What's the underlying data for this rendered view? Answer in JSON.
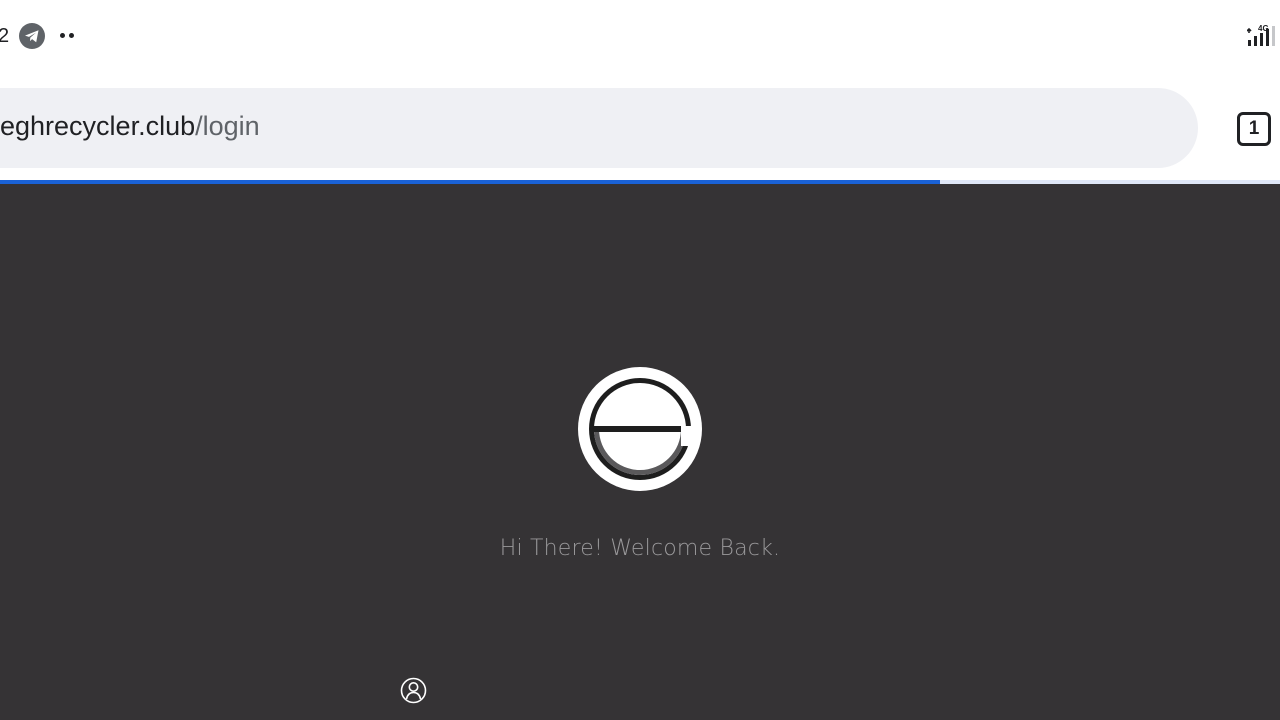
{
  "status_bar": {
    "time_fragment": "2",
    "icons": [
      "telegram-icon",
      "more-dots-icon",
      "signal-4g-icon"
    ]
  },
  "browser": {
    "url_host": "eghrecycler.club",
    "url_path": "/login",
    "tab_count": "1",
    "load_progress": 0.734,
    "accent_color": "#1a62d6"
  },
  "page": {
    "background_color": "#353335",
    "logo_icon": "recycler-e-logo-icon",
    "welcome_text": "Hi There! Welcome Back.",
    "username_icon": "user-icon"
  }
}
